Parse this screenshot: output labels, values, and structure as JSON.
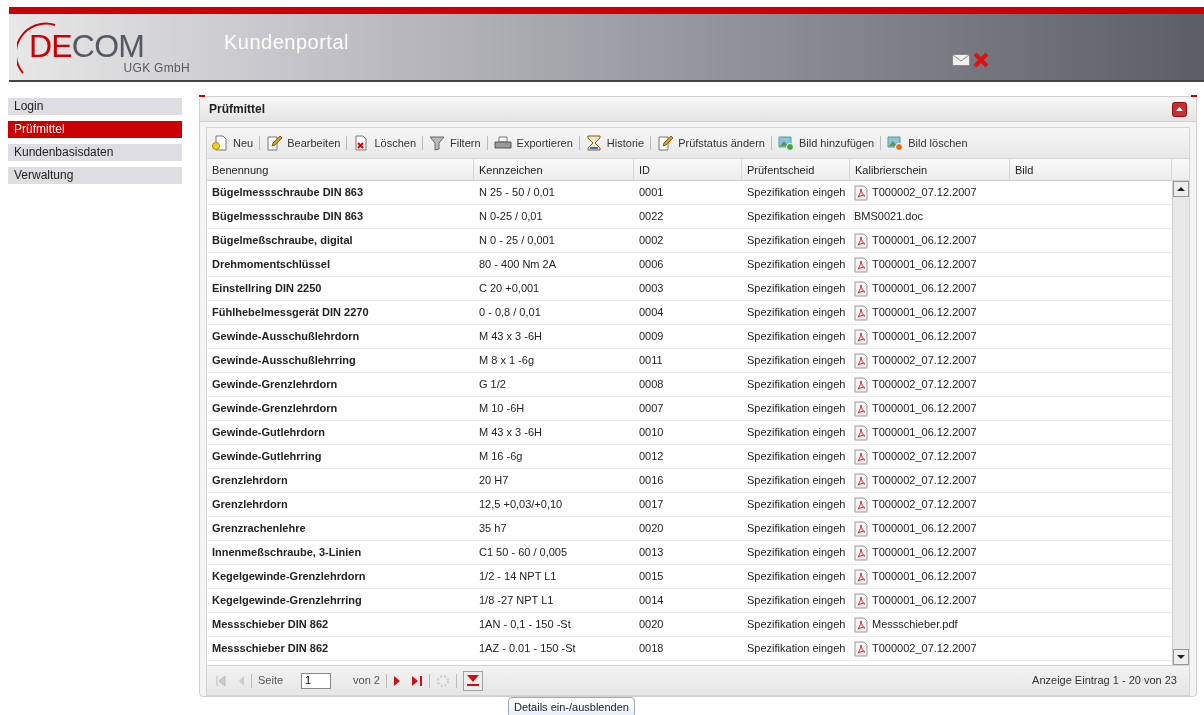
{
  "header": {
    "logo_main_red": "DE",
    "logo_main_gray": "COM",
    "logo_sub": "UGK GmbH",
    "title": "Kundenportal"
  },
  "sidebar": {
    "items": [
      {
        "label": "Login",
        "selected": false
      },
      {
        "label": "Prüfmittel",
        "selected": true
      },
      {
        "label": "Kundenbasisdaten",
        "selected": false
      },
      {
        "label": "Verwaltung",
        "selected": false
      }
    ]
  },
  "panel": {
    "title": "Prüfmittel",
    "toolbar": [
      {
        "label": "Neu"
      },
      {
        "label": "Bearbeiten"
      },
      {
        "label": "Löschen"
      },
      {
        "label": "Filtern"
      },
      {
        "label": "Exportieren"
      },
      {
        "label": "Historie"
      },
      {
        "label": "Prüfstatus ändern"
      },
      {
        "label": "Bild hinzufügen"
      },
      {
        "label": "Bild löschen"
      }
    ],
    "table": {
      "columns": [
        "Benennung",
        "Kennzeichen",
        "ID",
        "Prüfentscheid",
        "Kalibrierschein",
        "Bild"
      ],
      "rows": [
        {
          "benennung": "Bügelmessschraube DIN 863",
          "kennzeichen": "N 25 - 50 / 0,01",
          "id": "0001",
          "pruefentscheid": "Spezifikation eingeh",
          "file": {
            "kind": "pdf",
            "name": "T000002_07.12.2007"
          }
        },
        {
          "benennung": "Bügelmessschraube DIN 863",
          "kennzeichen": "N 0-25 / 0,01",
          "id": "0022",
          "pruefentscheid": "Spezifikation eingeh",
          "file": {
            "kind": "plain",
            "name": "BMS0021.doc"
          }
        },
        {
          "benennung": "Bügelmeßschraube, digital",
          "kennzeichen": "N 0 - 25 / 0,001",
          "id": "0002",
          "pruefentscheid": "Spezifikation eingeh",
          "file": {
            "kind": "pdf",
            "name": "T000001_06.12.2007"
          }
        },
        {
          "benennung": "Drehmomentschlüssel",
          "kennzeichen": "80 - 400 Nm 2A",
          "id": "0006",
          "pruefentscheid": "Spezifikation eingeh",
          "file": {
            "kind": "pdf",
            "name": "T000001_06.12.2007"
          }
        },
        {
          "benennung": "Einstellring DIN 2250",
          "kennzeichen": "C 20 +0,001",
          "id": "0003",
          "pruefentscheid": "Spezifikation eingeh",
          "file": {
            "kind": "pdf",
            "name": "T000001_06.12.2007"
          }
        },
        {
          "benennung": "Fühlhebelmessgerät DIN 2270",
          "kennzeichen": "0 - 0,8 / 0,01",
          "id": "0004",
          "pruefentscheid": "Spezifikation eingeh",
          "file": {
            "kind": "pdf",
            "name": "T000001_06.12.2007"
          }
        },
        {
          "benennung": "Gewinde-Ausschußlehrdorn",
          "kennzeichen": "M 43 x 3 -6H",
          "id": "0009",
          "pruefentscheid": "Spezifikation eingeh",
          "file": {
            "kind": "pdf",
            "name": "T000001_06.12.2007"
          }
        },
        {
          "benennung": "Gewinde-Ausschußlehrring",
          "kennzeichen": "M 8 x 1 -6g",
          "id": "0011",
          "pruefentscheid": "Spezifikation eingeh",
          "file": {
            "kind": "pdf",
            "name": "T000002_07.12.2007"
          }
        },
        {
          "benennung": "Gewinde-Grenzlehrdorn",
          "kennzeichen": "G 1/2",
          "id": "0008",
          "pruefentscheid": "Spezifikation eingeh",
          "file": {
            "kind": "pdf",
            "name": "T000002_07.12.2007"
          }
        },
        {
          "benennung": "Gewinde-Grenzlehrdorn",
          "kennzeichen": "M 10 -6H",
          "id": "0007",
          "pruefentscheid": "Spezifikation eingeh",
          "file": {
            "kind": "pdf",
            "name": "T000001_06.12.2007"
          }
        },
        {
          "benennung": "Gewinde-Gutlehrdorn",
          "kennzeichen": "M 43 x 3 -6H",
          "id": "0010",
          "pruefentscheid": "Spezifikation eingeh",
          "file": {
            "kind": "pdf",
            "name": "T000001_06.12.2007"
          }
        },
        {
          "benennung": "Gewinde-Gutlehrring",
          "kennzeichen": "M 16 -6g",
          "id": "0012",
          "pruefentscheid": "Spezifikation eingeh",
          "file": {
            "kind": "pdf",
            "name": "T000002_07.12.2007"
          }
        },
        {
          "benennung": "Grenzlehrdorn",
          "kennzeichen": "20 H7",
          "id": "0016",
          "pruefentscheid": "Spezifikation eingeh",
          "file": {
            "kind": "pdf",
            "name": "T000002_07.12.2007"
          }
        },
        {
          "benennung": "Grenzlehrdorn",
          "kennzeichen": "12,5 +0,03/+0,10",
          "id": "0017",
          "pruefentscheid": "Spezifikation eingeh",
          "file": {
            "kind": "pdf",
            "name": "T000002_07.12.2007"
          }
        },
        {
          "benennung": "Grenzrachenlehre",
          "kennzeichen": "35 h7",
          "id": "0020",
          "pruefentscheid": "Spezifikation eingeh",
          "file": {
            "kind": "pdf",
            "name": "T000001_06.12.2007"
          }
        },
        {
          "benennung": "Innenmeßschraube, 3-Linien",
          "kennzeichen": "C1 50 - 60 / 0,005",
          "id": "0013",
          "pruefentscheid": "Spezifikation eingeh",
          "file": {
            "kind": "pdf",
            "name": "T000001_06.12.2007"
          }
        },
        {
          "benennung": "Kegelgewinde-Grenzlehrdorn",
          "kennzeichen": "1/2 - 14 NPT L1",
          "id": "0015",
          "pruefentscheid": "Spezifikation eingeh",
          "file": {
            "kind": "pdf",
            "name": "T000001_06.12.2007"
          }
        },
        {
          "benennung": "Kegelgewinde-Grenzlehrring",
          "kennzeichen": "1/8 -27 NPT L1",
          "id": "0014",
          "pruefentscheid": "Spezifikation eingeh",
          "file": {
            "kind": "pdf",
            "name": "T000001_06.12.2007"
          }
        },
        {
          "benennung": "Messschieber DIN 862",
          "kennzeichen": "1AN - 0,1 - 150 -St",
          "id": "0020",
          "pruefentscheid": "Spezifikation eingeh",
          "file": {
            "kind": "pdf",
            "name": "Messschieber.pdf"
          }
        },
        {
          "benennung": "Messschieber DIN 862",
          "kennzeichen": "1AZ - 0.01 - 150 -St",
          "id": "0018",
          "pruefentscheid": "Spezifikation eingeh",
          "file": {
            "kind": "pdf",
            "name": "T000002_07.12.2007"
          }
        }
      ]
    },
    "pager": {
      "page_label": "Seite",
      "page_value": "1",
      "of_label": "von 2",
      "summary": "Anzeige Eintrag 1 - 20 von 23"
    },
    "tooltip": "Details ein-/ausblenden"
  }
}
